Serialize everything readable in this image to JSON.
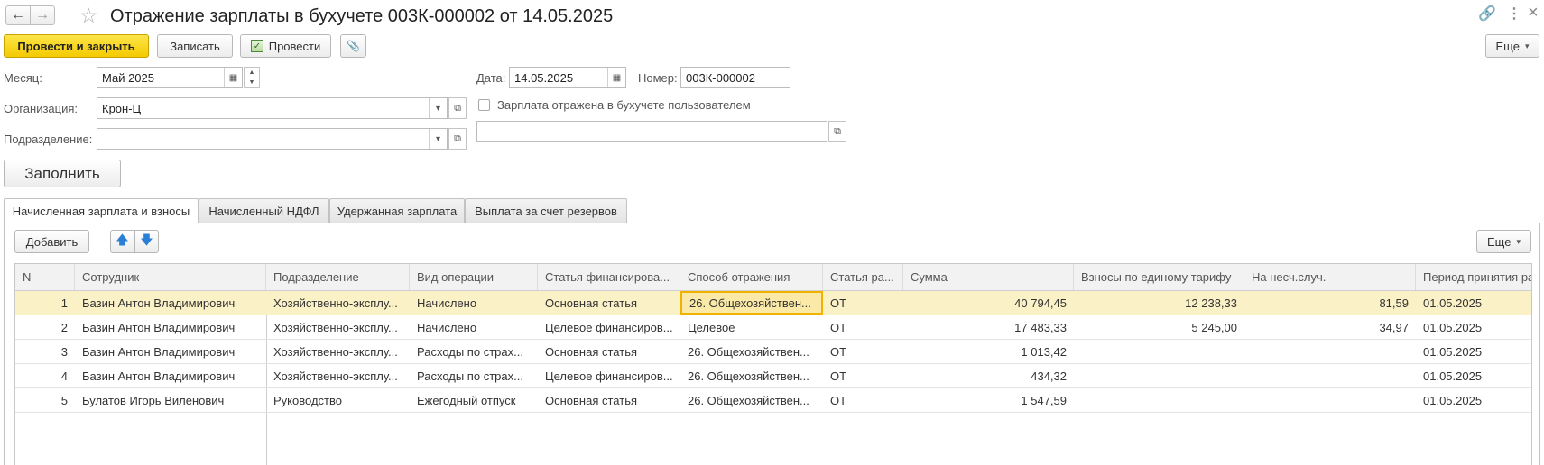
{
  "window": {
    "title": "Отражение зарплаты в бухучете 003К-000002 от 14.05.2025",
    "back_icon": "←",
    "forward_icon": "→",
    "star_icon": "☆",
    "link_icon": "🔗",
    "menu_icon": "⋮",
    "close_icon": "×"
  },
  "toolbar": {
    "post_close_label": "Провести и закрыть",
    "save_label": "Записать",
    "post_label": "Провести",
    "attach_icon": "📎",
    "more_label": "Еще"
  },
  "form": {
    "month_label": "Месяц:",
    "month_value": "Май 2025",
    "date_label": "Дата:",
    "date_value": "14.05.2025",
    "number_label": "Номер:",
    "number_value": "003К-000002",
    "org_label": "Организация:",
    "org_value": "Крон-Ц",
    "checkbox_label": "Зарплата отражена в бухучете пользователем",
    "division_label": "Подразделение:",
    "division_value": "",
    "extra_value": "",
    "fill_label": "Заполнить"
  },
  "tabs": [
    {
      "label": "Начисленная зарплата и взносы"
    },
    {
      "label": "Начисленный НДФЛ"
    },
    {
      "label": "Удержанная зарплата"
    },
    {
      "label": "Выплата за счет резервов"
    }
  ],
  "table_toolbar": {
    "add_label": "Добавить",
    "up_icon": "🡅",
    "down_icon": "🡇",
    "more_label": "Еще"
  },
  "table": {
    "columns": [
      "N",
      "Сотрудник",
      "Подразделение",
      "Вид операции",
      "Статья финансирова...",
      "Способ отражения",
      "Статья ра...",
      "Сумма",
      "Взносы по единому тарифу",
      "На несч.случ.",
      "Период принятия ра"
    ],
    "rows": [
      [
        "1",
        "Базин Антон Владимирович",
        "Хозяйственно-эксплу...",
        "Начислено",
        "Основная статья",
        "26. Общехозяйствен...",
        "ОТ",
        "40 794,45",
        "12 238,33",
        "81,59",
        "01.05.2025"
      ],
      [
        "2",
        "Базин Антон Владимирович",
        "Хозяйственно-эксплу...",
        "Начислено",
        "Целевое финансиров...",
        "Целевое",
        "ОТ",
        "17 483,33",
        "5 245,00",
        "34,97",
        "01.05.2025"
      ],
      [
        "3",
        "Базин Антон Владимирович",
        "Хозяйственно-эксплу...",
        "Расходы по страх...",
        "Основная статья",
        "26. Общехозяйствен...",
        "ОТ",
        "1 013,42",
        "",
        "",
        "01.05.2025"
      ],
      [
        "4",
        "Базин Антон Владимирович",
        "Хозяйственно-эксплу...",
        "Расходы по страх...",
        "Целевое финансиров...",
        "26. Общехозяйствен...",
        "ОТ",
        "434,32",
        "",
        "",
        "01.05.2025"
      ],
      [
        "5",
        "Булатов Игорь Виленович",
        "Руководство",
        "Ежегодный отпуск",
        "Основная статья",
        "26. Общехозяйствен...",
        "ОТ",
        "1 547,59",
        "",
        "",
        "01.05.2025"
      ]
    ]
  }
}
